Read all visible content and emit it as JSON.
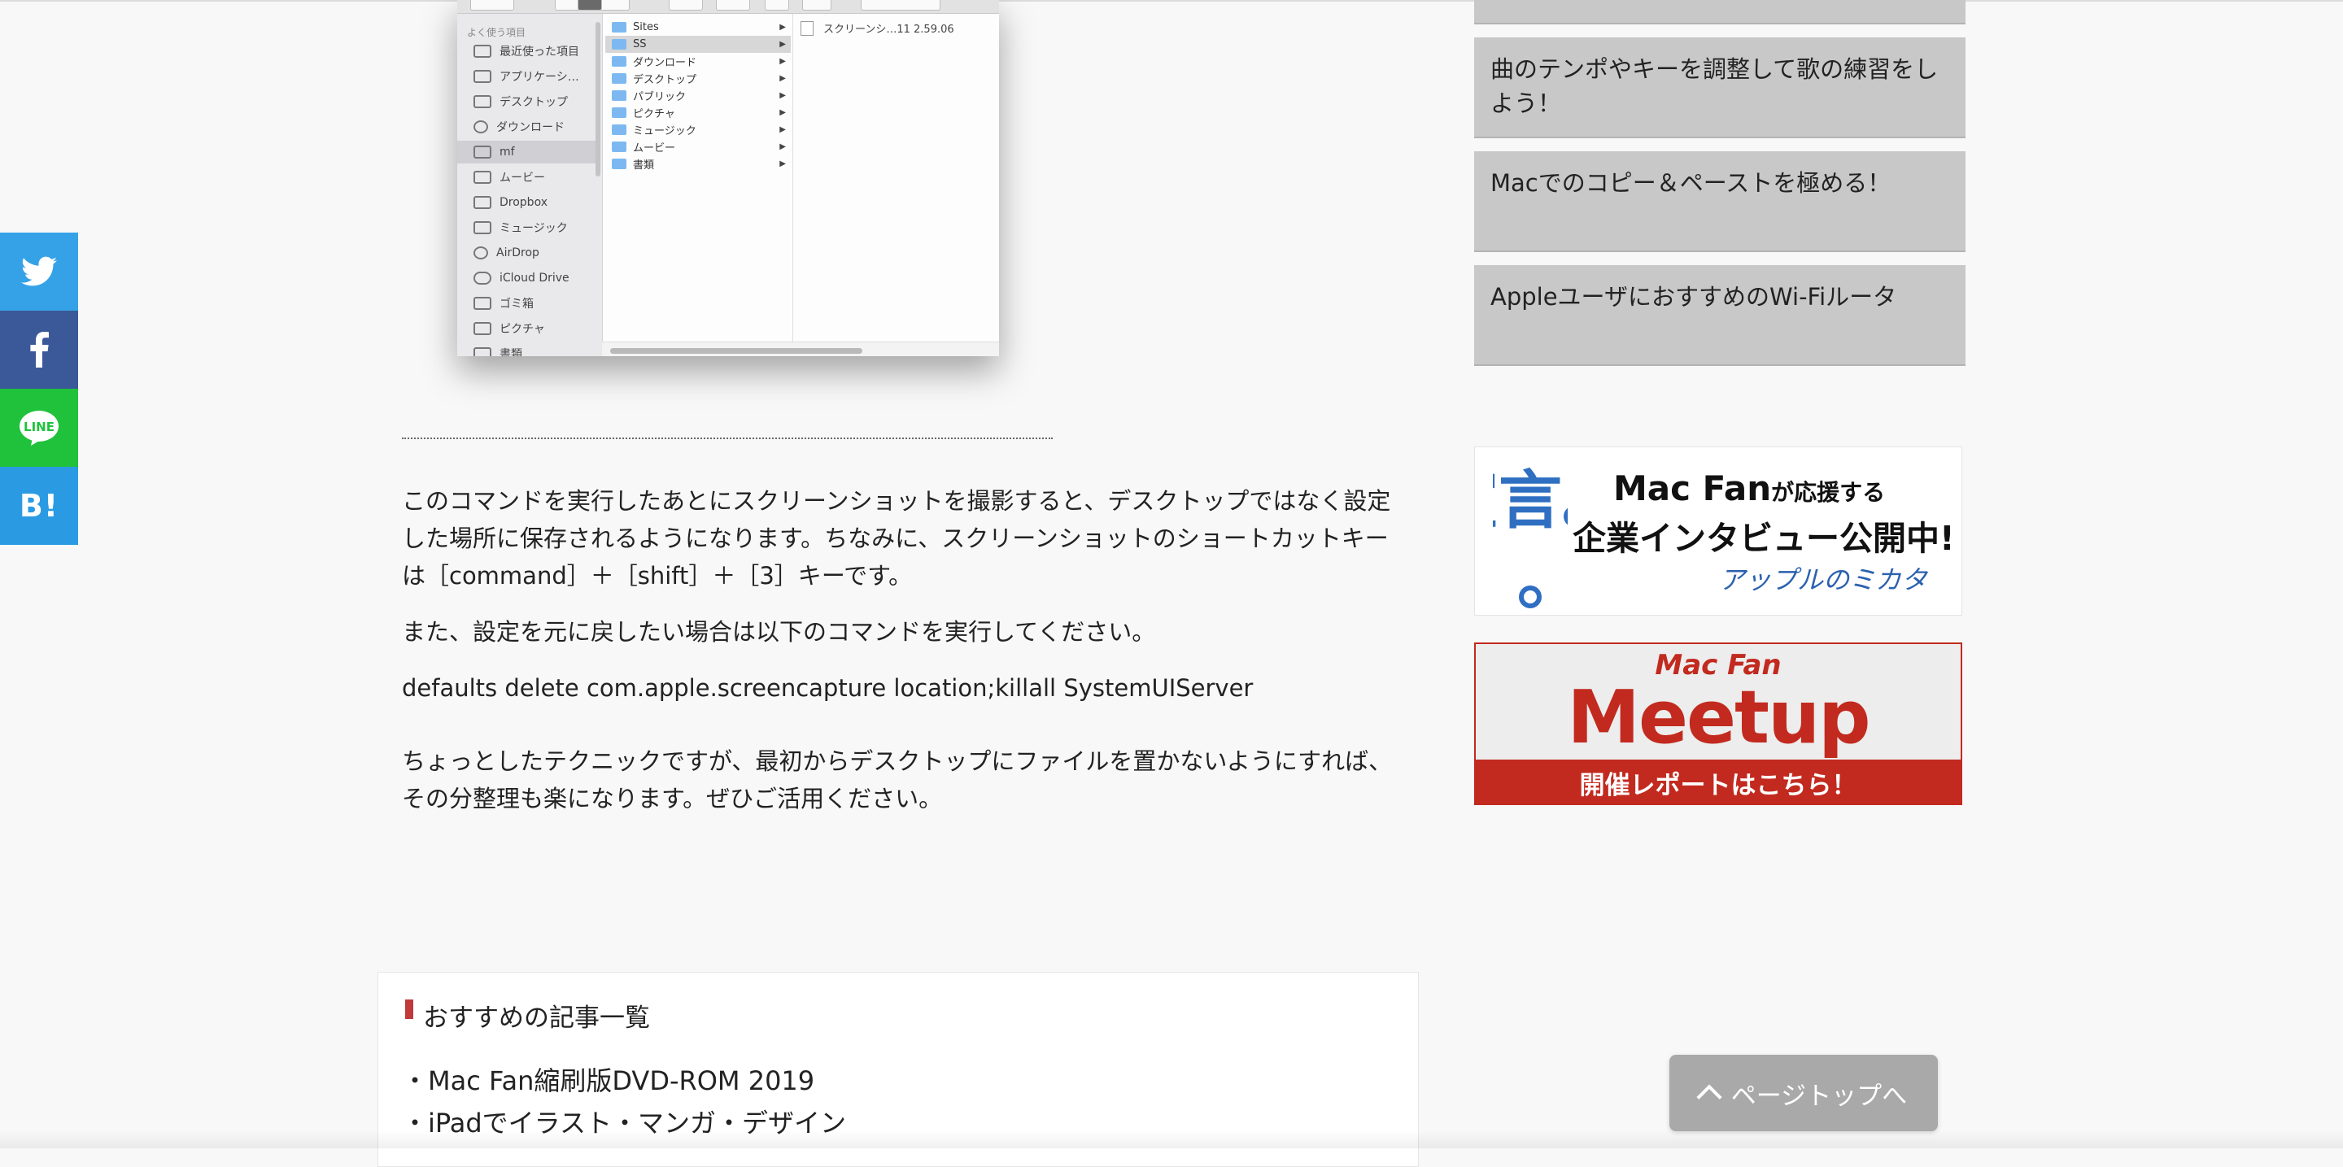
{
  "share": {
    "twitter_icon": "twitter-bird-icon",
    "facebook_icon": "facebook-f-icon",
    "line_icon": "line-icon",
    "line_label": "LINE",
    "hatena_label": "B!",
    "colors": {
      "twitter": "#35a2e7",
      "facebook": "#3b5998",
      "line": "#1fc23a",
      "hatena": "#2a9be3"
    }
  },
  "finder": {
    "section_label": "よく使う項目",
    "sidebar_items": [
      "最近使った項目",
      "アプリケーシ…",
      "デスクトップ",
      "ダウンロード",
      "mf",
      "ムービー",
      "Dropbox",
      "ミュージック",
      "AirDrop",
      "iCloud Drive",
      "ゴミ箱",
      "ピクチャ",
      "書類"
    ],
    "folders": [
      "Sites",
      "SS",
      "ダウンロード",
      "デスクトップ",
      "パブリック",
      "ピクチャ",
      "ミュージック",
      "ムービー",
      "書類"
    ],
    "file": "スクリーンシ…11 2.59.06"
  },
  "article": {
    "p1": "このコマンドを実行したあとにスクリーンショットを撮影すると、デスクトップではなく設定した場所に保存されるようになります。ちなみに、スクリーンショットのショートカットキーは［command］＋［shift］＋［3］キーです。",
    "p2": "また、設定を元に戻したい場合は以下のコマンドを実行してください。",
    "p3": "defaults delete com.apple.screencapture location;killall SystemUIServer",
    "p4": "ちょっとしたテクニックですが、最初からデスクトップにファイルを置かないようにすれば、その分整理も楽になります。ぜひご活用ください。"
  },
  "recommended": {
    "title": "おすすめの記事一覧",
    "items": [
      "・Mac Fan縮刷版DVD-ROM 2019",
      "・iPadでイラスト・マンガ・デザイン"
    ]
  },
  "sidebar": {
    "cards": [
      "",
      "曲のテンポやキーを調整して歌の練習をしよう！",
      "Macでのコピー＆ペーストを極める！",
      "AppleユーザにおすすめのWi-Fiルータ"
    ]
  },
  "banner1": {
    "side_text": "宣言。",
    "line1_a": "Mac Fan",
    "line1_b": "が応援する",
    "line2": "企業インタビュー公開中!",
    "line3": "アップルのミカタ"
  },
  "banner2": {
    "small": "Mac Fan",
    "big": "Meetup",
    "band": "開催レポートはこちら！",
    "color": "#c22a1f"
  },
  "pagetop": {
    "label": "ページトップへ"
  }
}
